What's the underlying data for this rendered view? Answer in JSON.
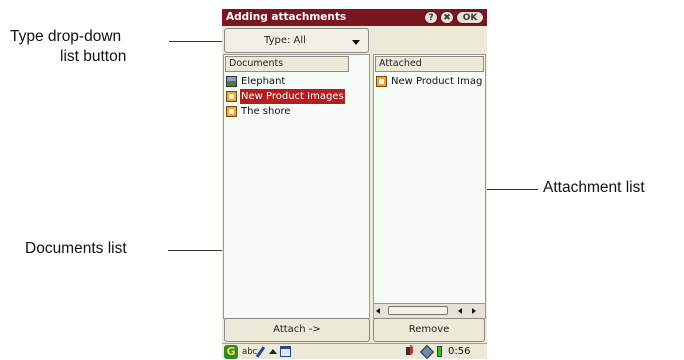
{
  "window": {
    "title": "Adding attachments",
    "help_label": "?",
    "close_label": "✖",
    "ok_label": "OK"
  },
  "type_dropdown": {
    "label": "Type: All"
  },
  "documents": {
    "header": "Documents",
    "items": [
      {
        "label": "Elephant",
        "icon": "image-icon",
        "selected": false
      },
      {
        "label": "New Product Images",
        "icon": "document-icon",
        "selected": true
      },
      {
        "label": "The shore",
        "icon": "document-icon",
        "selected": false
      }
    ]
  },
  "attachments": {
    "header": "Attached",
    "items": [
      {
        "label": "New Product Imag",
        "icon": "document-icon"
      }
    ]
  },
  "buttons": {
    "attach": "Attach ->",
    "remove": "Remove"
  },
  "statusbar": {
    "input_mode": "abc",
    "clock": "0:56"
  },
  "callouts": {
    "type_dropdown_line1": "Type drop-down",
    "type_dropdown_line2": "list button",
    "attachment_list": "Attachment list",
    "documents_list": "Documents list"
  },
  "colors": {
    "titlebar": "#7a1622",
    "selection": "#b41e22",
    "list_background": "#f6fbf6",
    "chrome": "#ece9d8"
  }
}
